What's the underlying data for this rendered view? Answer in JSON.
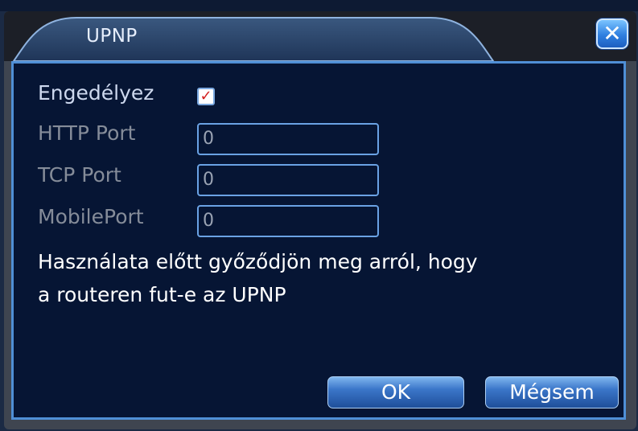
{
  "dialog": {
    "title": "UPNP",
    "close_icon": "close-icon"
  },
  "form": {
    "enable": {
      "label": "Engedélyez",
      "checked": true,
      "check_mark": "✓"
    },
    "http_port": {
      "label": "HTTP Port",
      "value": "0"
    },
    "tcp_port": {
      "label": "TCP Port",
      "value": "0"
    },
    "mobile_port": {
      "label": "MobilePort",
      "value": "0"
    }
  },
  "note": {
    "line1": "Használata előtt győződjön meg arról, hogy",
    "line2": "a routeren fut-e az UPNP"
  },
  "buttons": {
    "ok": "OK",
    "cancel": "Mégsem"
  },
  "colors": {
    "panel_bg": "#061534",
    "accent_border": "#4f8fd6",
    "check_color": "#d21e1e"
  }
}
